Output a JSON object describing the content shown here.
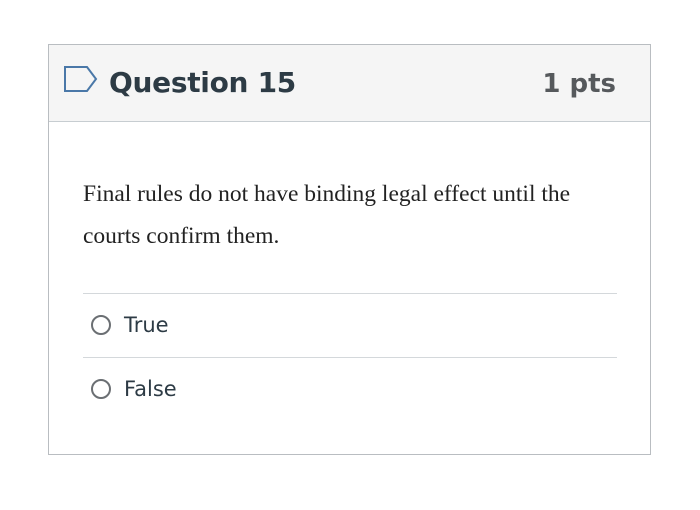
{
  "question": {
    "title": "Question 15",
    "points": "1 pts",
    "flag_icon": "flag-outline-icon",
    "text": "Final rules do not have binding legal effect until the courts confirm them.",
    "answers": [
      {
        "label": "True",
        "selected": false
      },
      {
        "label": "False",
        "selected": false
      }
    ]
  },
  "colors": {
    "header_bg": "#f5f5f5",
    "border": "#b9bdc1",
    "flag": "#4a78a8",
    "title_text": "#2d3b45"
  }
}
